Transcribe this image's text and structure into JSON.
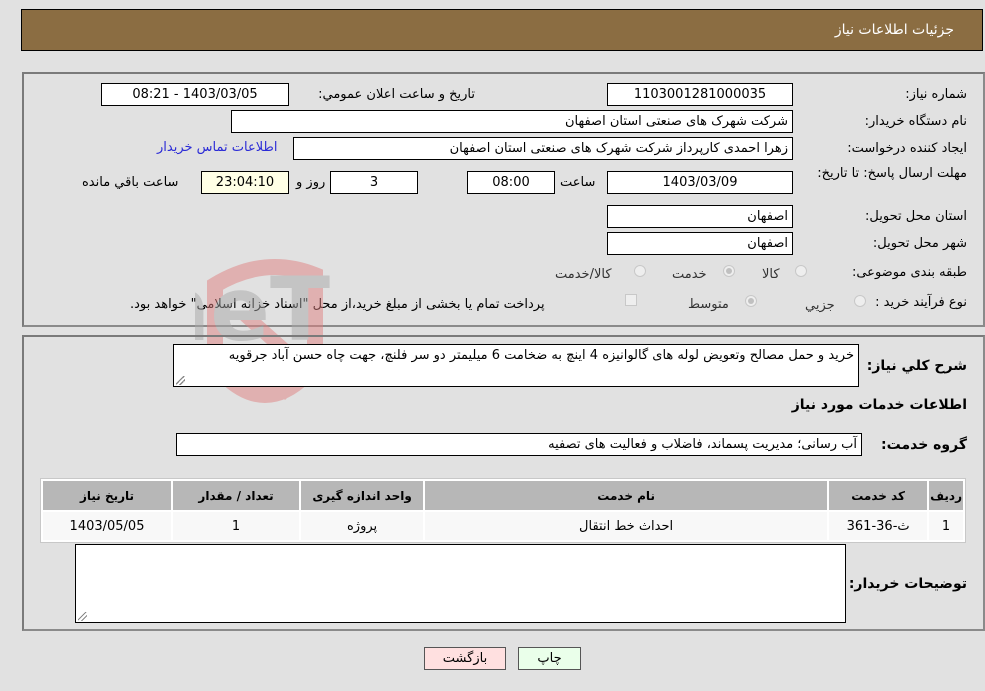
{
  "header": {
    "title": "جزئیات اطلاعات نیاز"
  },
  "fields": {
    "need_number": {
      "label": "شماره نیاز:",
      "value": "1103001281000035"
    },
    "announce_datetime": {
      "label": "تاریخ و ساعت اعلان عمومي:",
      "value": "1403/03/05 - 08:21"
    },
    "buyer_org": {
      "label": "نام دستگاه خریدار:",
      "value": "شرکت شهرک های صنعتی استان اصفهان"
    },
    "requester": {
      "label": "ایجاد کننده درخواست:",
      "value": "زهرا احمدی کارپرداز شرکت شهرک های صنعتی استان اصفهان"
    },
    "buyer_contact_link": "اطلاعات تماس خریدار",
    "deadline": {
      "label": "مهلت ارسال پاسخ: تا تاریخ:",
      "date": "1403/03/09",
      "time_label": "ساعت",
      "time": "08:00",
      "days": "3",
      "days_label": "روز و",
      "remaining": "23:04:10",
      "remaining_label": "ساعت باقي مانده"
    },
    "delivery_province": {
      "label": "استان محل تحویل:",
      "value": "اصفهان"
    },
    "delivery_city": {
      "label": "شهر محل تحویل:",
      "value": "اصفهان"
    },
    "category": {
      "label": "طبقه بندی موضوعی:",
      "options": [
        "کالا",
        "خدمت",
        "کالا/خدمت"
      ],
      "selected": "خدمت"
    },
    "purchase_type": {
      "label": "نوع فرآیند خرید :",
      "options": [
        "جزيي",
        "متوسط"
      ],
      "selected": "متوسط",
      "treasury_checkbox_label": "پرداخت تمام یا بخشی از مبلغ خرید،از محل \"اسناد خزانه اسلامی\" خواهد بود.",
      "treasury_checked": false
    }
  },
  "description": {
    "label": "شرح كلي نياز:",
    "value": "خرید و حمل مصالح وتعویض لوله های گالوانیزه 4 اینچ به ضخامت 6 میلیمتر دو سر فلنچ، جهت چاه حسن آباد جرقویه"
  },
  "services_section_title": "اطلاعات خدمات مورد نياز",
  "service_group": {
    "label": "گروه خدمت:",
    "value": "آب رسانی؛ مدیریت پسماند، فاضلاب و فعالیت های تصفیه"
  },
  "table": {
    "headers": [
      "رديف",
      "کد خدمت",
      "نام خدمت",
      "واحد اندازه گیری",
      "تعداد / مقدار",
      "تاريخ نياز"
    ],
    "rows": [
      [
        "1",
        "ث-36-361",
        "احداث خط انتقال",
        "پروژه",
        "1",
        "1403/05/05"
      ]
    ]
  },
  "buyer_notes": {
    "label": "توضیحات خریدار:",
    "value": ""
  },
  "buttons": {
    "print": "چاپ",
    "back": "بازگشت"
  },
  "watermark": {
    "text": "AriaTender.neT"
  }
}
